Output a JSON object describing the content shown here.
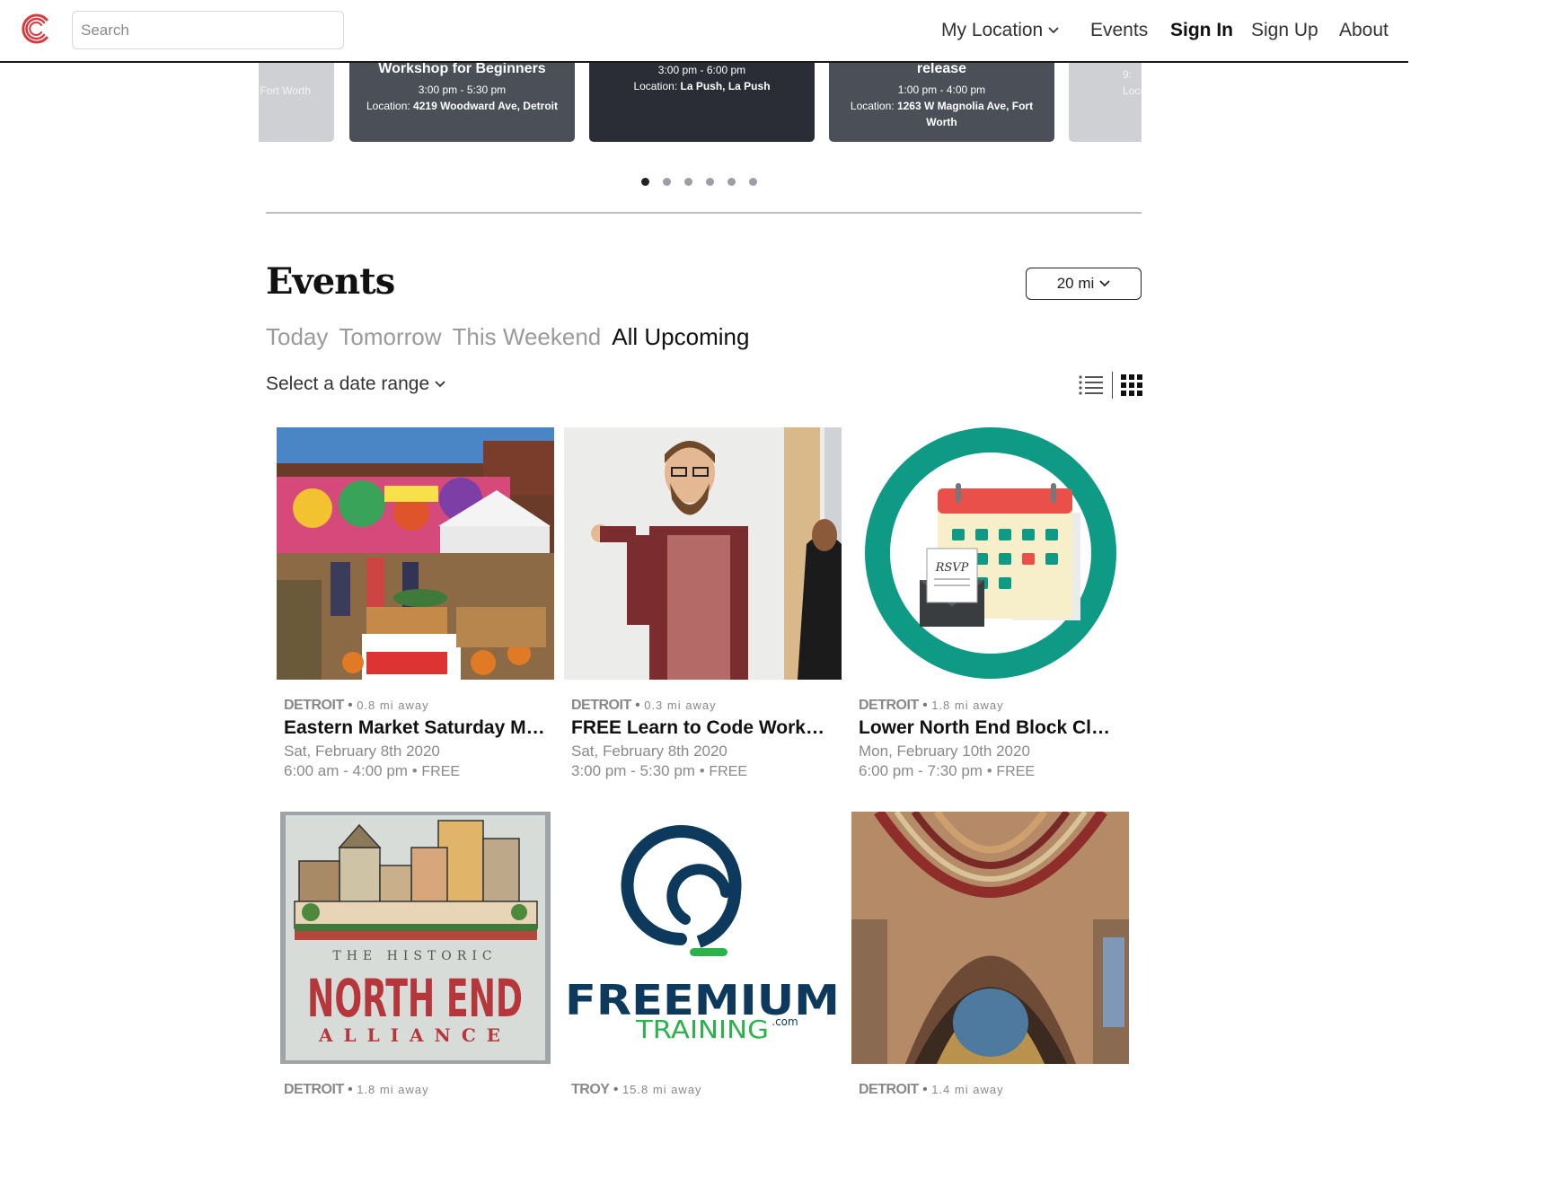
{
  "header": {
    "search_placeholder": "Search",
    "nav": {
      "location": "My Location",
      "events": "Events",
      "sign_in": "Sign In",
      "sign_up": "Sign Up",
      "about": "About"
    }
  },
  "carousel": {
    "slides": [
      {
        "title": "",
        "time": "m",
        "location": "Fort Worth"
      },
      {
        "title": "Workshop for Beginners",
        "time": "3:00 pm - 5:30 pm",
        "location_label": "Location:",
        "location": "4219 Woodward Ave, Detroit"
      },
      {
        "title": "",
        "time": "3:00 pm - 6:00 pm",
        "location_label": "Location:",
        "location": "La Push, La Push"
      },
      {
        "title": "release",
        "time": "1:00 pm - 4:00 pm",
        "location_label": "Location:",
        "location": "1263 W Magnolia Ave, Fort Worth"
      },
      {
        "title": "",
        "time": "9:",
        "location": "Locat"
      }
    ],
    "dot_count": 6,
    "active_dot": 0
  },
  "events": {
    "heading": "Events",
    "radius": "20 mi",
    "tabs": [
      "Today",
      "Tomorrow",
      "This Weekend",
      "All Upcoming"
    ],
    "active_tab": 3,
    "date_range": "Select a date range",
    "cards": [
      {
        "city": "DETROIT",
        "distance": "0.8 mi away",
        "title": "Eastern Market Saturday Market",
        "date": "Sat, February 8th 2020",
        "time": "6:00 am - 4:00 pm",
        "price": "FREE",
        "image": "market"
      },
      {
        "city": "DETROIT",
        "distance": "0.3 mi away",
        "title": "FREE Learn to Code Workshop",
        "date": "Sat, February 8th 2020",
        "time": "3:00 pm - 5:30 pm",
        "price": "FREE",
        "image": "teacher"
      },
      {
        "city": "DETROIT",
        "distance": "1.8 mi away",
        "title": "Lower North End Block Club Meeting",
        "date": "Mon, February 10th 2020",
        "time": "6:00 pm - 7:30 pm",
        "price": "FREE",
        "image": "rsvp",
        "rsvp_text": "RSVP"
      },
      {
        "city": "DETROIT",
        "distance": "1.8 mi away",
        "image": "northend",
        "logo_small": "THE HISTORIC",
        "logo_big": "NORTH END",
        "logo_bottom": "ALLIANCE"
      },
      {
        "city": "TROY",
        "distance": "15.8 mi away",
        "image": "freemium",
        "logo_big": "FREEMIUM",
        "logo_sub": "TRAINING",
        "logo_suffix": ".com"
      },
      {
        "city": "DETROIT",
        "distance": "1.4 mi away",
        "image": "cathedral"
      }
    ]
  },
  "colors": {
    "brand": "#d83a3f",
    "rsvp_ring": "#0f9a86",
    "freemium_navy": "#0d3a5c",
    "freemium_green": "#2bb24c",
    "northend_red": "#b5373c"
  }
}
